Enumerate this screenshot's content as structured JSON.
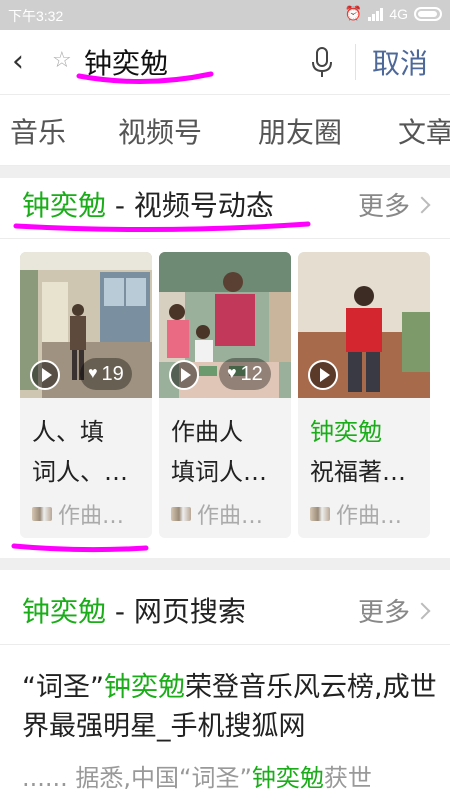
{
  "status_bar": {
    "time": "下午3:32",
    "network": "4G"
  },
  "search": {
    "back_icon": "back-arrow-icon",
    "query": "钟奕勉",
    "cancel_label": "取消"
  },
  "tabs": [
    "音乐",
    "视频号",
    "朋友圈",
    "文章"
  ],
  "video_section": {
    "keyword": "钟奕勉",
    "title_suffix": " - 视频号动态",
    "more_label": "更多",
    "cards": [
      {
        "likes": "19",
        "title_line1": "人、填",
        "title_line2": "词人、…",
        "title_highlight": "",
        "author": "作曲…"
      },
      {
        "likes": "12",
        "title_line1": "作曲人",
        "title_line2": "填词人…",
        "title_highlight": "",
        "author": "作曲…"
      },
      {
        "likes": "",
        "title_line1": "钟奕勉",
        "title_line2": "祝福著…",
        "title_highlight": "钟奕勉",
        "author": "作曲…"
      }
    ]
  },
  "web_section": {
    "keyword": "钟奕勉",
    "title_suffix": " - 网页搜索",
    "more_label": "更多",
    "result": {
      "title_pre": "“词圣”",
      "title_hl": "钟奕勉",
      "title_post": "荣登音乐风云榜,成世界最强明星_手机搜狐网",
      "snippet_pre": "...... 据悉,中国“词圣”",
      "snippet_hl": "钟奕勉",
      "snippet_post": "获世"
    }
  },
  "colors": {
    "highlight": "#1aad19",
    "cancel": "#4d6899",
    "annotation": "#ff00ff"
  }
}
